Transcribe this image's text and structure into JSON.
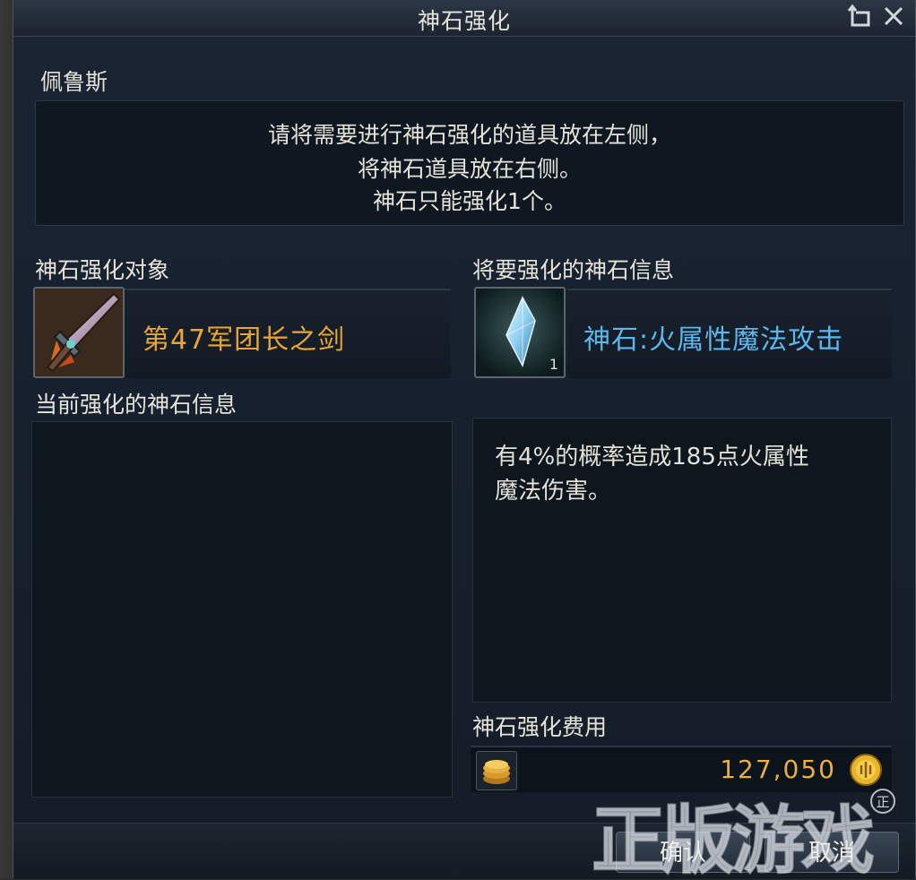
{
  "window": {
    "title": "神石强化",
    "npc_name": "佩鲁斯"
  },
  "message": {
    "lines": [
      "请将需要进行神石强化的道具放在左侧，",
      "将神石道具放在右侧。",
      "神石只能强化1个。"
    ]
  },
  "target": {
    "label": "神石强化对象",
    "item_name": "第47军团长之剑",
    "item_name_color": "#e8a634"
  },
  "stone": {
    "label": "将要强化的神石信息",
    "item_name": "神石:火属性魔法攻击",
    "item_name_color": "#5cb8ec",
    "count": "1"
  },
  "current": {
    "label": "当前强化的神石信息"
  },
  "stone_desc": {
    "lines": [
      "有4%的概率造成185点火属性",
      "魔法伤害。"
    ]
  },
  "cost": {
    "label": "神石强化费用",
    "value": "127,050"
  },
  "buttons": {
    "confirm": "确认",
    "cancel": "取消"
  },
  "watermark": {
    "text": "正版游戏",
    "mark": "正"
  }
}
